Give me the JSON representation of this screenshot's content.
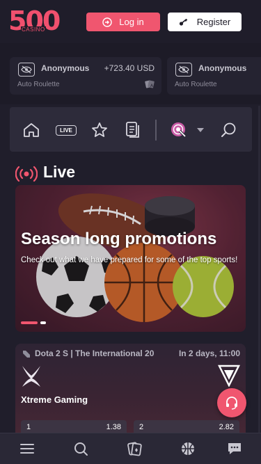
{
  "header": {
    "logo_number": "500",
    "logo_sub": "CASINO",
    "login_label": "Log in",
    "register_label": "Register"
  },
  "wins": [
    {
      "user": "Anonymous",
      "amount": "+723.40 USD",
      "game": "Auto Roulette"
    },
    {
      "user": "Anonymous",
      "game": "Auto Roulette"
    }
  ],
  "nav": {
    "live_label": "LIVE",
    "icons": [
      "home-icon",
      "live-icon",
      "star-icon",
      "betslip-icon",
      "esports-icon",
      "chevron-down-icon",
      "search-icon"
    ]
  },
  "section": {
    "title": "Live"
  },
  "banner": {
    "title": "Season long promotions",
    "text": "Check out what we have prepared for some of the top sports!",
    "slides": 2,
    "active_slide": 1
  },
  "match": {
    "league": "Dota 2 S | The International 20",
    "time": "In 2 days, 11:00",
    "team1": "Xtreme Gaming",
    "team2": "Tu",
    "odds": [
      {
        "label": "1",
        "value": "1.38"
      },
      {
        "label": "2",
        "value": "2.82"
      }
    ]
  },
  "bottom_nav": [
    "menu-icon",
    "search-icon",
    "casino-cards-icon",
    "basketball-icon",
    "chat-icon"
  ],
  "colors": {
    "accent": "#f0566f",
    "background": "#1d1b27",
    "panel": "#2d2b3a"
  }
}
